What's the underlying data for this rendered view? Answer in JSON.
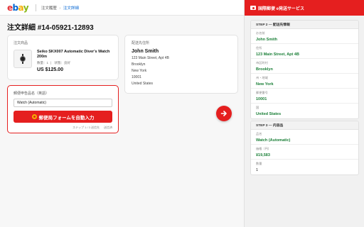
{
  "app": {
    "logo": [
      "e",
      "b",
      "a",
      "y"
    ],
    "breadcrumb": {
      "parent": "注文履歴",
      "separator": "›",
      "current": "注文詳細"
    },
    "page_title": "注文詳細 #14-05921-12893"
  },
  "product": {
    "section_label": "注文商品",
    "name": "Seiko SKX007 Automatic Diver's Watch 200m",
    "qty_label": "数量：1",
    "status_label": "状態：良好",
    "price": "US $125.00"
  },
  "shipping": {
    "section_label": "配送先住所",
    "name": "John Smith",
    "lines": [
      "123 Main Street, Apt 4B",
      "Brooklyn",
      "New York",
      "10001",
      "United States"
    ]
  },
  "helper": {
    "label": "郵便申告品名（英語）",
    "input_value": "Watch (Automatic)",
    "button_label": "郵便局フォームを自動入力",
    "footer_step": "ステップ 1 / 3 送信先",
    "footer_link": "送信済"
  },
  "panel": {
    "title": "国際郵便 e発送サービス",
    "step2": {
      "heading": "STEP 2 — 配送先情報",
      "fields": [
        {
          "label": "お名前",
          "value": "John Smith"
        },
        {
          "label": "住所",
          "value": "123 Main Street, Apt 4B"
        },
        {
          "label": "市区町村",
          "value": "Brooklyn"
        },
        {
          "label": "州・地域",
          "value": "New York"
        },
        {
          "label": "郵便番号",
          "value": "10001"
        },
        {
          "label": "国",
          "value": "United States"
        }
      ]
    },
    "step3": {
      "heading": "STEP 3 — 内容品",
      "fields": [
        {
          "label": "品名",
          "value": "Watch (Automatic)"
        },
        {
          "label": "価格（円）",
          "value": "¥19,583"
        },
        {
          "label": "数量",
          "value": "1"
        }
      ]
    }
  },
  "colors": {
    "ebay_red": "#e53238",
    "ebay_blue": "#0064d2",
    "ebay_yellow": "#f5af02",
    "ebay_green": "#86b817",
    "accent_red": "#e51f1f",
    "filled_green": "#1a7f37"
  }
}
